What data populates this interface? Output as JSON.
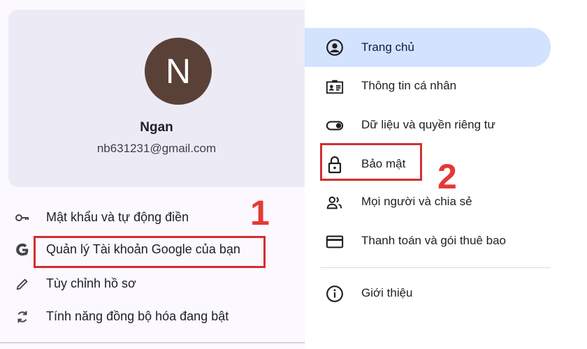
{
  "profile": {
    "avatar_letter": "N",
    "name": "Ngan",
    "email": "nb631231@gmail.com",
    "avatar_color": "#5a4138"
  },
  "chrome_menu": {
    "items": [
      {
        "label": "Mật khẩu và tự động điền",
        "icon": "key-icon"
      },
      {
        "label": "Quản lý Tài khoản Google của bạn",
        "icon": "google-g-icon"
      },
      {
        "label": "Tùy chỉnh hồ sơ",
        "icon": "pencil-icon"
      },
      {
        "label": "Tính năng đồng bộ hóa đang bật",
        "icon": "sync-icon"
      }
    ]
  },
  "account_nav": {
    "items": [
      {
        "label": "Trang chủ",
        "icon": "account-circle-icon",
        "selected": true
      },
      {
        "label": "Thông tin cá nhân",
        "icon": "id-card-icon"
      },
      {
        "label": "Dữ liệu và quyền riêng tư",
        "icon": "toggle-icon"
      },
      {
        "label": "Bảo mật",
        "icon": "lock-icon"
      },
      {
        "label": "Mọi người và chia sẻ",
        "icon": "people-icon"
      },
      {
        "label": "Thanh toán và gói thuê bao",
        "icon": "credit-card-icon"
      },
      {
        "label": "Giới thiệu",
        "icon": "info-icon"
      }
    ]
  },
  "annotations": {
    "step_1": "1",
    "step_2": "2",
    "highlight_color": "#d32f2f"
  }
}
